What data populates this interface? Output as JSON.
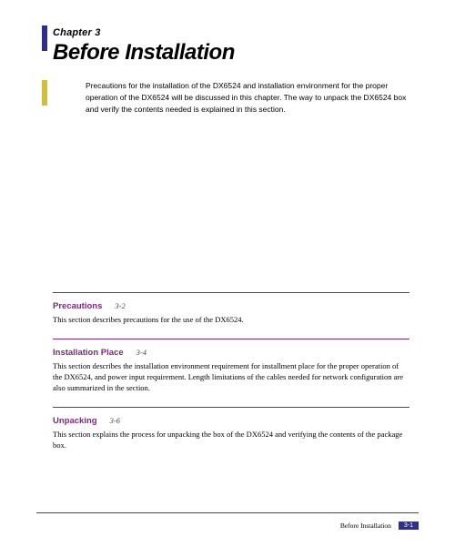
{
  "header": {
    "chapter_label": "Chapter 3",
    "chapter_title": "Before Installation",
    "intro": "Precautions for the installation of the DX6524 and installation environment for the proper operation of the DX6524 will be discussed in this chapter.    The way to unpack the DX6524 box and verify the contents needed is explained in this section."
  },
  "sections": [
    {
      "title": "Precautions",
      "page": "3-2",
      "desc": "This section describes precautions for the use of the DX6524."
    },
    {
      "title": "Installation Place",
      "page": "3-4",
      "desc": "This section describes the installation environment requirement for installment place for the proper operation of the DX6524, and power input requirement.\nLength limitations of the cables needed for network configuration are also summarized in the section."
    },
    {
      "title": "Unpacking",
      "page": "3-6",
      "desc": "This section explains the process for unpacking the box of the DX6524 and verifying the contents of the package box."
    }
  ],
  "footer": {
    "text": "Before Installation",
    "page_number": "3-1"
  }
}
